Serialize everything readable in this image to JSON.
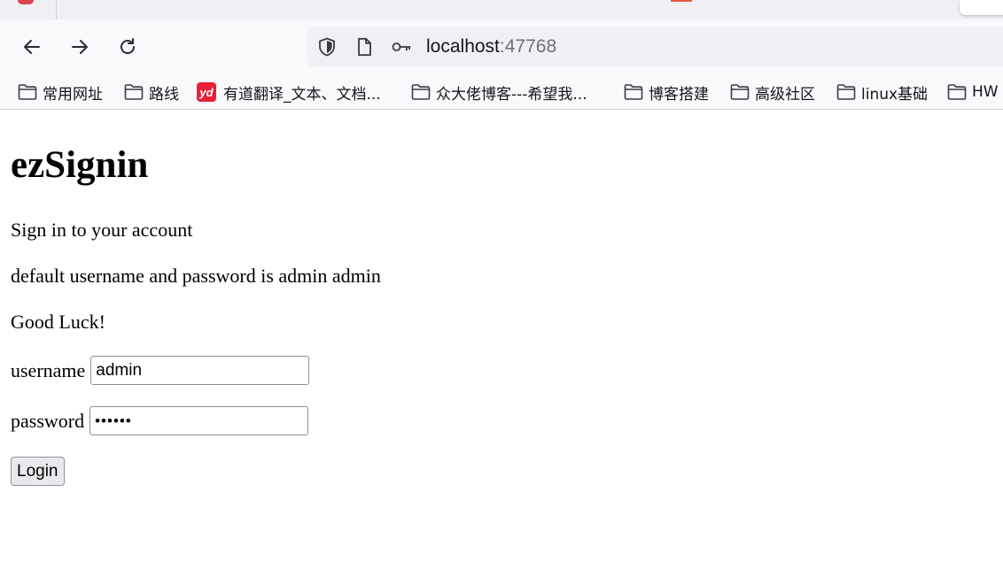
{
  "browser": {
    "url_host": "localhost",
    "url_port": ":47768",
    "bookmarks": [
      {
        "label": "常用网址",
        "icon": "folder-icon"
      },
      {
        "label": "路线",
        "icon": "folder-icon"
      },
      {
        "label": "有道翻译_文本、文档...",
        "icon": "youdao-icon",
        "icon_text": "yd"
      },
      {
        "label": "众大佬博客---希望我...",
        "icon": "folder-icon"
      },
      {
        "label": "博客搭建",
        "icon": "folder-icon"
      },
      {
        "label": "高级社区",
        "icon": "folder-icon"
      },
      {
        "label": "linux基础",
        "icon": "folder-icon"
      },
      {
        "label": "HW",
        "icon": "folder-icon"
      }
    ]
  },
  "page": {
    "title": "ezSignin",
    "subtitle": "Sign in to your account",
    "hint": "default username and password is admin admin",
    "luck": "Good Luck!",
    "username_label": "username",
    "username_value": "admin",
    "password_label": "password",
    "password_value": "admin1",
    "login_label": "Login"
  }
}
